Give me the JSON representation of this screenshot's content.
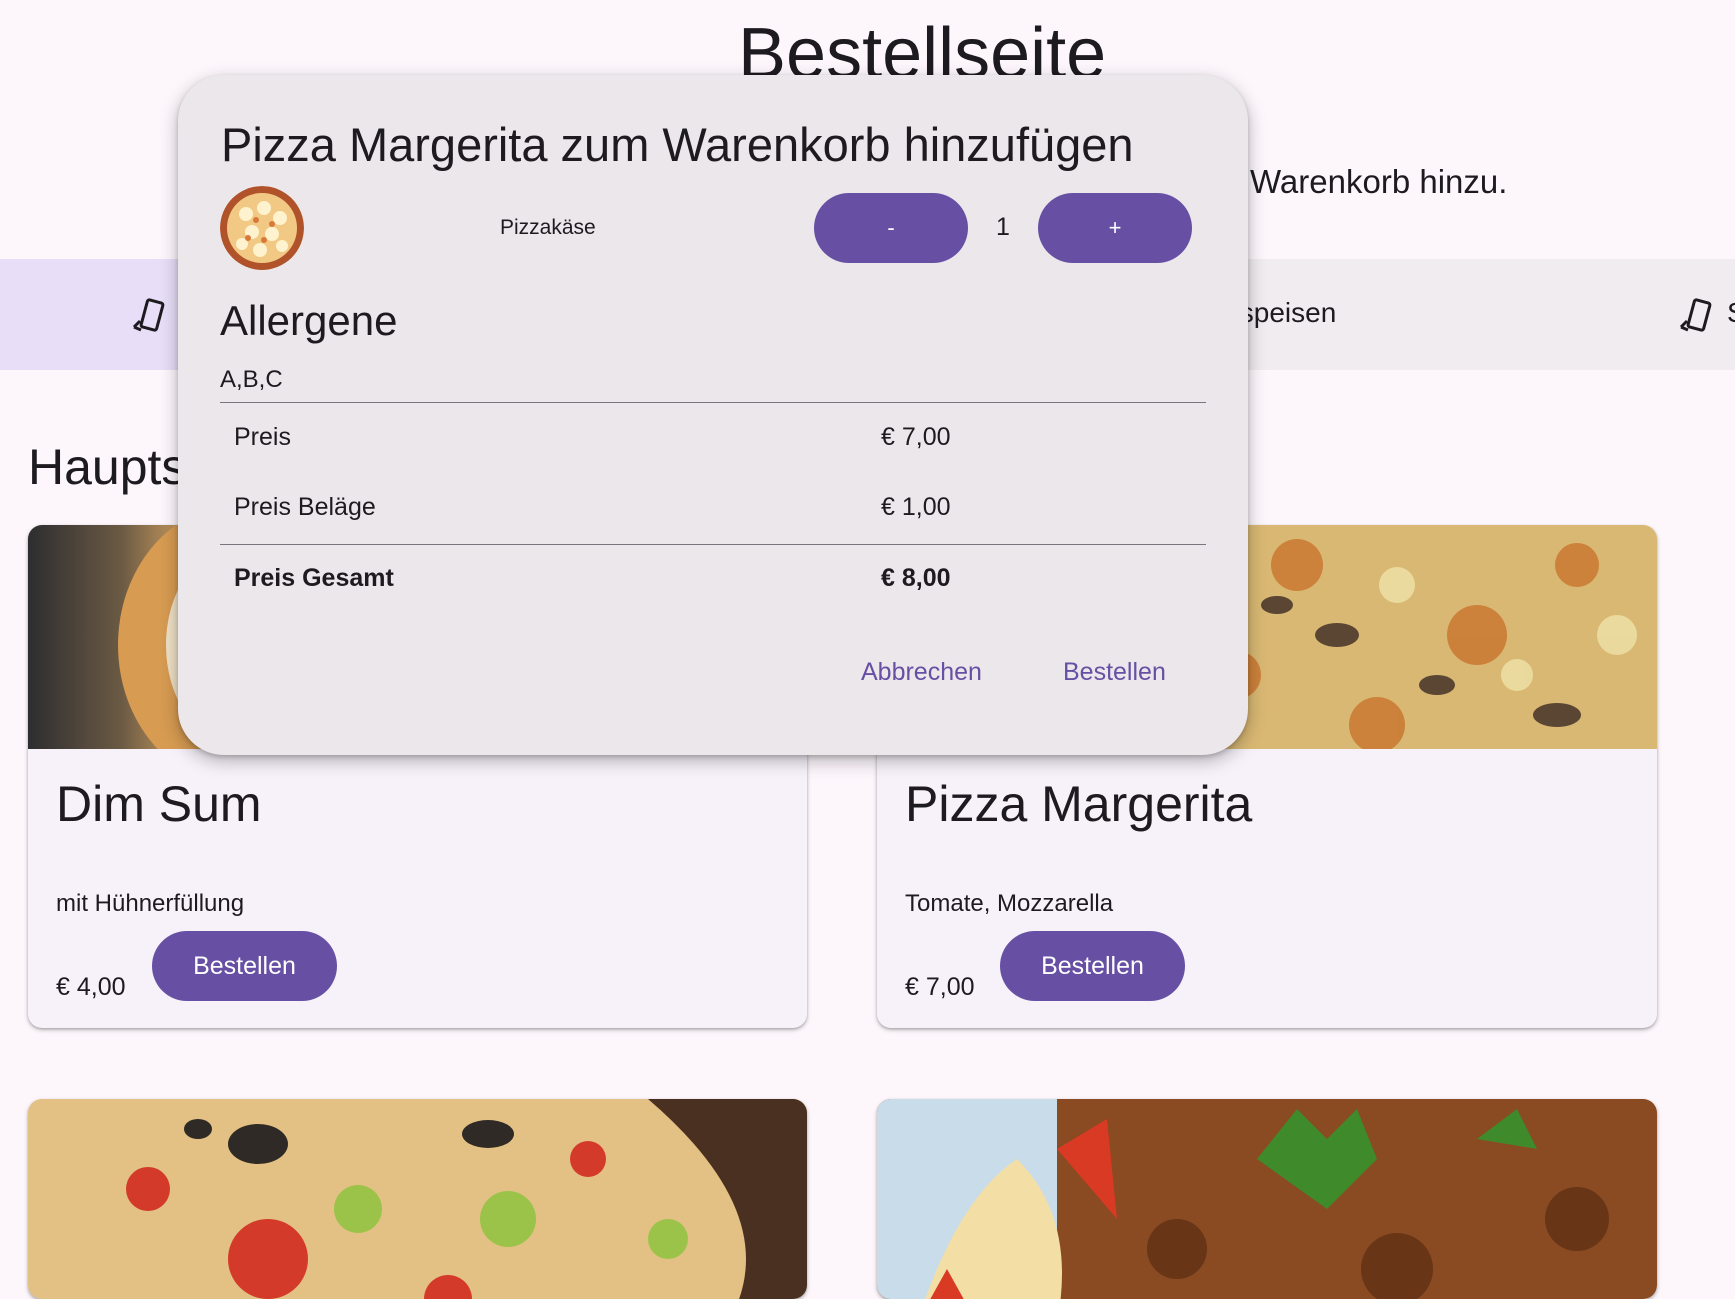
{
  "page": {
    "title": "Bestellseite",
    "intro_text": "Warenkorb hinzu."
  },
  "categories": {
    "items": [
      {
        "label": "",
        "icon": "phone-rotate-icon",
        "active": true
      },
      {
        "label": "ıspeisen",
        "icon": "phone-rotate-icon",
        "active": false
      },
      {
        "label": "S",
        "icon": "phone-rotate-icon",
        "active": false
      }
    ]
  },
  "section": {
    "title": "Haupts"
  },
  "cards": [
    {
      "title": "Dim Sum",
      "description": "mit Hühnerfüllung",
      "price": "€ 4,00",
      "button": "Bestellen"
    },
    {
      "title": "Pizza Margerita",
      "description": "Tomate, Mozzarella",
      "price": "€ 7,00",
      "button": "Bestellen"
    }
  ],
  "dialog": {
    "title": "Pizza Margerita zum Warenkorb hinzufügen",
    "topping_name": "Pizzakäse",
    "decrement_label": "-",
    "increment_label": "+",
    "quantity": "1",
    "allergens_title": "Allergene",
    "allergens_value": "A,B,C",
    "price_label": "Preis",
    "price_value": "€ 7,00",
    "toppings_price_label": "Preis Beläge",
    "toppings_price_value": "€ 1,00",
    "total_label": "Preis Gesamt",
    "total_value": "€ 8,00",
    "cancel_label": "Abbrechen",
    "order_label": "Bestellen"
  },
  "colors": {
    "primary": "#6750a4",
    "active_pill": "#e8def8",
    "dialog_bg": "#ece7ea",
    "page_bg": "#fdf7fc"
  }
}
